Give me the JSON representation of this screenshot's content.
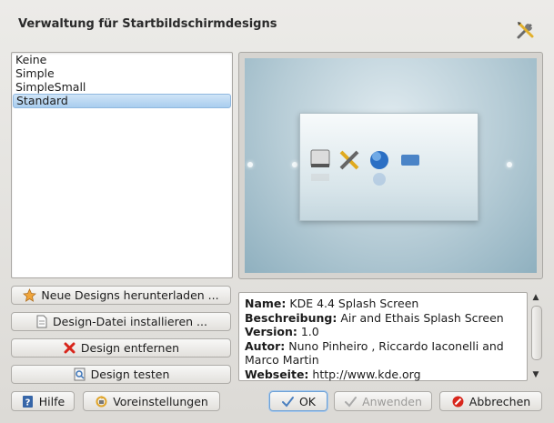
{
  "dialog": {
    "title": "Verwaltung für Startbildschirmdesigns",
    "title_icon": "tools-icon"
  },
  "theme_list": {
    "items": [
      "Keine",
      "Simple",
      "SimpleSmall",
      "Standard"
    ],
    "selected": "Standard"
  },
  "actions": {
    "download_label": "Neue Designs herunterladen ...",
    "install_label": "Design-Datei installieren ...",
    "remove_label": "Design entfernen",
    "test_label": "Design testen"
  },
  "info": {
    "name_label": "Name:",
    "name_value": " KDE 4.4 Splash Screen",
    "desc_label": "Beschreibung:",
    "desc_value": " Air and Ethais Splash Screen",
    "version_label": "Version:",
    "version_value": " 1.0",
    "author_label": "Autor:",
    "author_value": " Nuno Pinheiro , Riccardo Iaconelli and Marco Martin",
    "website_label": "Webseite:",
    "website_value": " http://www.kde.org"
  },
  "footer": {
    "help_label": "Hilfe",
    "defaults_label": "Voreinstellungen",
    "ok_label": "OK",
    "apply_label": "Anwenden",
    "cancel_label": "Abbrechen"
  },
  "colors": {
    "selection": "#a9cdee",
    "preview_bg": "#b6ccd6",
    "remove_icon": "#d8261c"
  }
}
